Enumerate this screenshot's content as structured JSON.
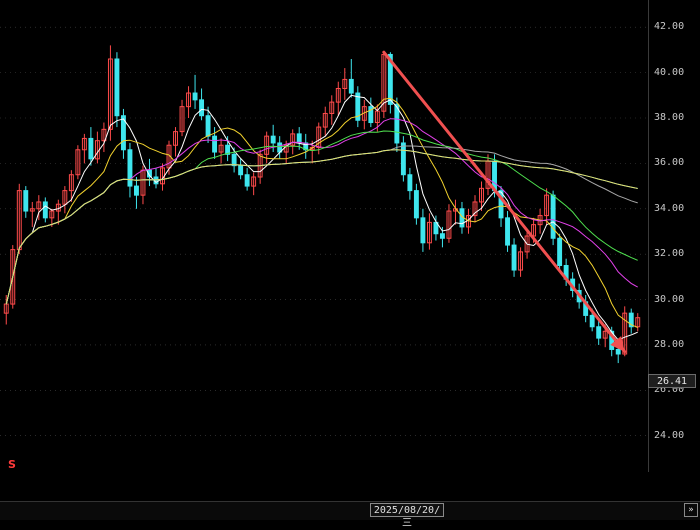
{
  "chart_data": {
    "type": "candlestick",
    "ylim": [
      22.4,
      43.2
    ],
    "grid": true,
    "y_ticks": [
      "42.00",
      "40.00",
      "38.00",
      "36.00",
      "34.00",
      "32.00",
      "30.00",
      "28.00",
      "26.00",
      "24.00"
    ],
    "last_price": "26.41",
    "crosshair_date": "2025/08/20/三",
    "marker": "S",
    "trend_arrow": {
      "from_close": 40.9,
      "to_close": 27.7
    },
    "candles": [
      [
        29.4,
        30.2,
        28.9,
        29.8
      ],
      [
        29.8,
        32.4,
        29.6,
        32.2
      ],
      [
        32.2,
        35.1,
        32.0,
        34.8
      ],
      [
        34.8,
        35.0,
        33.6,
        33.9
      ],
      [
        33.9,
        34.3,
        33.2,
        34.0
      ],
      [
        34.0,
        34.6,
        33.5,
        34.3
      ],
      [
        34.3,
        34.5,
        33.4,
        33.6
      ],
      [
        33.6,
        34.0,
        33.2,
        33.9
      ],
      [
        33.9,
        34.4,
        33.3,
        34.2
      ],
      [
        34.2,
        35.0,
        33.8,
        34.8
      ],
      [
        34.8,
        35.7,
        34.3,
        35.5
      ],
      [
        35.5,
        36.8,
        35.3,
        36.6
      ],
      [
        36.6,
        37.3,
        36.0,
        37.1
      ],
      [
        37.1,
        37.6,
        35.9,
        36.2
      ],
      [
        36.2,
        37.4,
        36.0,
        37.0
      ],
      [
        37.0,
        37.8,
        36.5,
        37.5
      ],
      [
        37.5,
        41.2,
        37.0,
        40.6
      ],
      [
        40.6,
        40.9,
        37.6,
        38.1
      ],
      [
        38.1,
        38.4,
        36.2,
        36.6
      ],
      [
        36.6,
        36.9,
        34.5,
        35.0
      ],
      [
        35.0,
        35.4,
        34.0,
        34.6
      ],
      [
        34.6,
        35.9,
        34.2,
        35.7
      ],
      [
        35.7,
        36.2,
        35.0,
        35.4
      ],
      [
        35.4,
        35.8,
        34.9,
        35.1
      ],
      [
        35.1,
        36.0,
        34.8,
        35.8
      ],
      [
        35.8,
        37.0,
        35.5,
        36.8
      ],
      [
        36.8,
        37.6,
        36.3,
        37.4
      ],
      [
        37.4,
        38.8,
        37.2,
        38.5
      ],
      [
        38.5,
        39.4,
        38.0,
        39.1
      ],
      [
        39.1,
        39.9,
        38.4,
        38.8
      ],
      [
        38.8,
        39.3,
        37.9,
        38.1
      ],
      [
        38.1,
        38.5,
        36.9,
        37.2
      ],
      [
        37.2,
        37.6,
        36.2,
        36.5
      ],
      [
        36.5,
        37.1,
        36.0,
        36.8
      ],
      [
        36.8,
        37.2,
        36.1,
        36.4
      ],
      [
        36.4,
        36.7,
        35.6,
        35.9
      ],
      [
        35.9,
        36.2,
        35.3,
        35.5
      ],
      [
        35.5,
        35.8,
        34.8,
        35.0
      ],
      [
        35.0,
        35.6,
        34.6,
        35.4
      ],
      [
        35.4,
        36.6,
        35.1,
        36.4
      ],
      [
        36.4,
        37.4,
        36.0,
        37.2
      ],
      [
        37.2,
        37.7,
        36.5,
        36.9
      ],
      [
        36.9,
        37.2,
        36.2,
        36.5
      ],
      [
        36.5,
        37.0,
        36.0,
        36.8
      ],
      [
        36.8,
        37.5,
        36.4,
        37.3
      ],
      [
        37.3,
        37.6,
        36.6,
        36.9
      ],
      [
        36.9,
        37.3,
        36.2,
        36.6
      ],
      [
        36.6,
        37.0,
        36.0,
        36.7
      ],
      [
        36.7,
        37.8,
        36.4,
        37.6
      ],
      [
        37.6,
        38.5,
        37.2,
        38.2
      ],
      [
        38.2,
        39.0,
        37.7,
        38.7
      ],
      [
        38.7,
        39.6,
        38.1,
        39.3
      ],
      [
        39.3,
        40.2,
        38.8,
        39.7
      ],
      [
        39.7,
        40.6,
        38.9,
        39.1
      ],
      [
        39.1,
        39.4,
        37.6,
        37.9
      ],
      [
        37.9,
        38.8,
        37.5,
        38.5
      ],
      [
        38.5,
        38.9,
        37.6,
        37.8
      ],
      [
        37.8,
        38.6,
        37.4,
        38.3
      ],
      [
        38.3,
        40.9,
        38.0,
        40.8
      ],
      [
        40.8,
        40.9,
        38.2,
        38.6
      ],
      [
        38.6,
        38.9,
        36.5,
        36.9
      ],
      [
        36.9,
        37.2,
        35.2,
        35.5
      ],
      [
        35.5,
        35.8,
        34.4,
        34.8
      ],
      [
        34.8,
        35.1,
        33.3,
        33.6
      ],
      [
        33.6,
        34.0,
        32.1,
        32.5
      ],
      [
        32.5,
        33.8,
        32.2,
        33.4
      ],
      [
        33.4,
        33.7,
        32.6,
        32.9
      ],
      [
        32.9,
        33.2,
        32.3,
        32.7
      ],
      [
        32.7,
        34.2,
        32.5,
        33.9
      ],
      [
        33.9,
        34.4,
        33.3,
        34.0
      ],
      [
        34.0,
        34.3,
        32.9,
        33.2
      ],
      [
        33.2,
        34.0,
        32.9,
        33.7
      ],
      [
        33.7,
        34.6,
        33.4,
        34.3
      ],
      [
        34.3,
        35.2,
        33.9,
        34.9
      ],
      [
        34.9,
        36.4,
        34.6,
        36.1
      ],
      [
        36.1,
        36.4,
        34.5,
        34.8
      ],
      [
        34.8,
        35.0,
        33.2,
        33.6
      ],
      [
        33.6,
        33.9,
        32.1,
        32.4
      ],
      [
        32.4,
        32.7,
        31.0,
        31.3
      ],
      [
        31.3,
        32.3,
        31.0,
        32.1
      ],
      [
        32.1,
        33.0,
        31.8,
        32.8
      ],
      [
        32.8,
        33.6,
        32.5,
        33.3
      ],
      [
        33.3,
        34.0,
        32.9,
        33.7
      ],
      [
        33.7,
        34.9,
        33.3,
        34.6
      ],
      [
        34.6,
        34.8,
        32.4,
        32.7
      ],
      [
        32.7,
        32.9,
        31.2,
        31.5
      ],
      [
        31.5,
        31.8,
        30.6,
        30.9
      ],
      [
        30.9,
        31.2,
        30.1,
        30.4
      ],
      [
        30.4,
        30.7,
        29.6,
        29.9
      ],
      [
        29.9,
        30.2,
        29.0,
        29.3
      ],
      [
        29.3,
        29.6,
        28.6,
        28.8
      ],
      [
        28.8,
        29.1,
        28.0,
        28.3
      ],
      [
        28.3,
        28.9,
        27.9,
        28.6
      ],
      [
        28.6,
        28.8,
        27.5,
        27.8
      ],
      [
        27.8,
        28.2,
        27.2,
        27.6
      ],
      [
        27.6,
        29.7,
        27.5,
        29.4
      ],
      [
        29.4,
        29.6,
        28.5,
        28.8
      ],
      [
        28.8,
        29.4,
        28.6,
        29.2
      ]
    ]
  }
}
